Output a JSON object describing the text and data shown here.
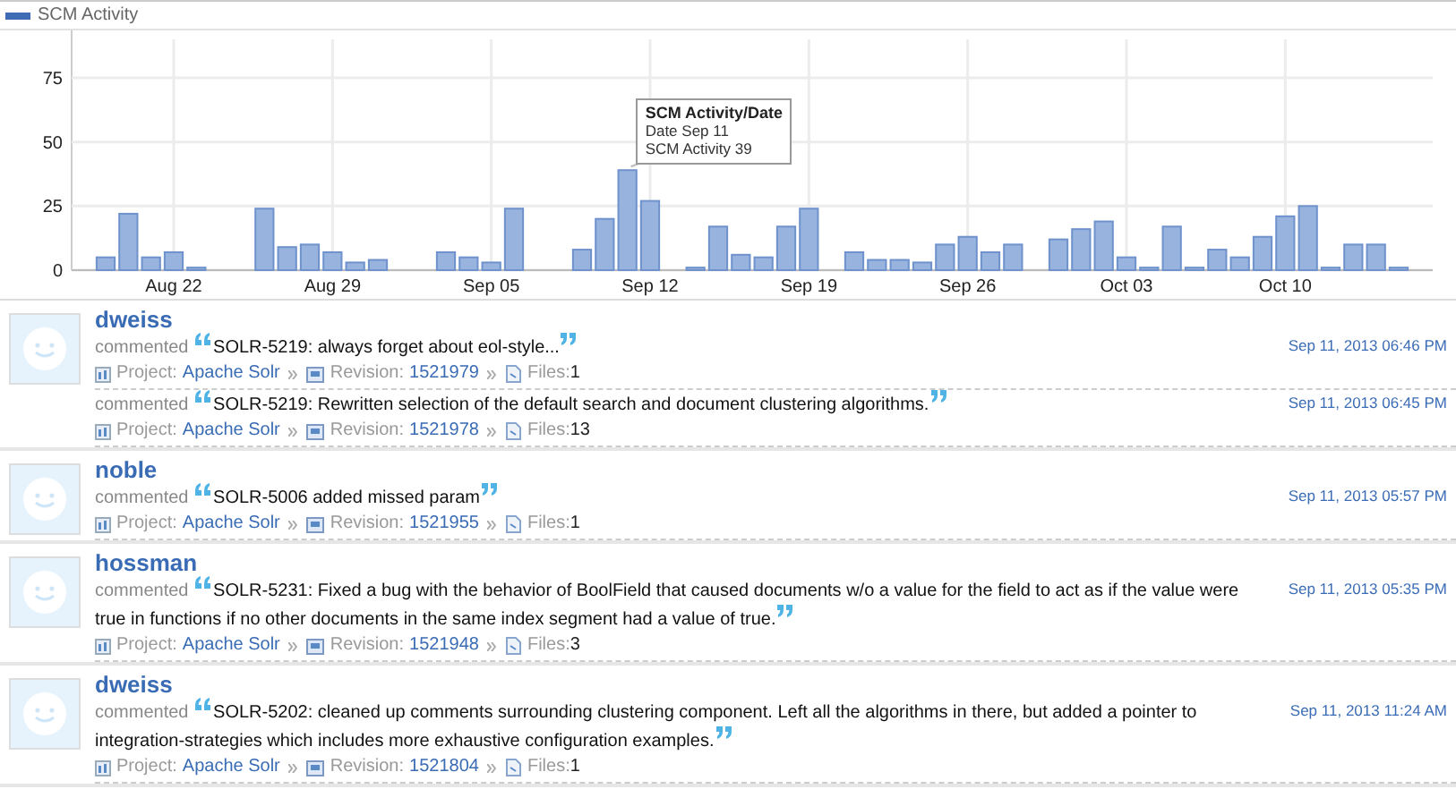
{
  "chart_data": {
    "type": "bar",
    "grid": true,
    "categories": [
      null,
      null,
      null,
      null,
      "Aug 22",
      null,
      null,
      null,
      null,
      null,
      null,
      "Aug 29",
      null,
      null,
      null,
      null,
      null,
      null,
      "Sep 05",
      null,
      null,
      null,
      null,
      null,
      null,
      "Sep 12",
      null,
      null,
      null,
      null,
      null,
      null,
      "Sep 19",
      null,
      null,
      null,
      null,
      null,
      null,
      "Sep 26",
      null,
      null,
      null,
      null,
      null,
      null,
      "Oct 03",
      null,
      null,
      null,
      null,
      null,
      null,
      "Oct 10",
      null,
      null,
      null,
      null,
      null,
      null
    ],
    "series": [
      {
        "name": "SCM Activity",
        "color": "#98b4de",
        "values": [
          0,
          5,
          22,
          5,
          7,
          1,
          0,
          0,
          24,
          9,
          10,
          7,
          3,
          4,
          0,
          0,
          7,
          5,
          3,
          24,
          0,
          0,
          8,
          20,
          39,
          27,
          0,
          1,
          17,
          6,
          5,
          17,
          24,
          0,
          7,
          4,
          4,
          3,
          10,
          13,
          7,
          10,
          0,
          12,
          16,
          19,
          5,
          1,
          17,
          1,
          8,
          5,
          13,
          21,
          25,
          1,
          10,
          10,
          1,
          0
        ]
      }
    ],
    "ylim": [
      0,
      90
    ],
    "yticks": [
      0,
      25,
      50,
      75
    ]
  },
  "tooltip": {
    "title": "SCM Activity/Date",
    "lines": [
      "Date Sep 11",
      "SCM Activity 39"
    ]
  },
  "feed": [
    {
      "user": "dweiss",
      "commits": [
        {
          "verb": "commented",
          "message": "SOLR-5219: always forget about eol-style...",
          "time": "Sep 11, 2013 06:46 PM",
          "project_label": "Project:",
          "project": "Apache Solr",
          "revision_label": "Revision:",
          "revision": "1521979",
          "files_label": "Files:",
          "files": "1"
        },
        {
          "verb": "commented",
          "message": "SOLR-5219: Rewritten selection of the default search and document clustering algorithms.",
          "time": "Sep 11, 2013 06:45 PM",
          "project_label": "Project:",
          "project": "Apache Solr",
          "revision_label": "Revision:",
          "revision": "1521978",
          "files_label": "Files:",
          "files": "13"
        }
      ]
    },
    {
      "user": "noble",
      "commits": [
        {
          "verb": "commented",
          "message": "SOLR-5006 added missed param",
          "time": "Sep 11, 2013 05:57 PM",
          "project_label": "Project:",
          "project": "Apache Solr",
          "revision_label": "Revision:",
          "revision": "1521955",
          "files_label": "Files:",
          "files": "1"
        }
      ]
    },
    {
      "user": "hossman",
      "commits": [
        {
          "verb": "commented",
          "message": "SOLR-5231: Fixed a bug with the behavior of BoolField that caused documents w/o a value for the field to act as if the value were true in functions if no other documents in the same index segment had a value of true.",
          "time": "Sep 11, 2013 05:35 PM",
          "project_label": "Project:",
          "project": "Apache Solr",
          "revision_label": "Revision:",
          "revision": "1521948",
          "files_label": "Files:",
          "files": "3"
        }
      ]
    },
    {
      "user": "dweiss",
      "commits": [
        {
          "verb": "commented",
          "message": "SOLR-5202: cleaned up comments surrounding clustering component. Left all the algorithms in there, but added a pointer to integration-strategies which includes more exhaustive configuration examples.",
          "time": "Sep 11, 2013 11:24 AM",
          "project_label": "Project:",
          "project": "Apache Solr",
          "revision_label": "Revision:",
          "revision": "1521804",
          "files_label": "Files:",
          "files": "1"
        }
      ]
    }
  ]
}
